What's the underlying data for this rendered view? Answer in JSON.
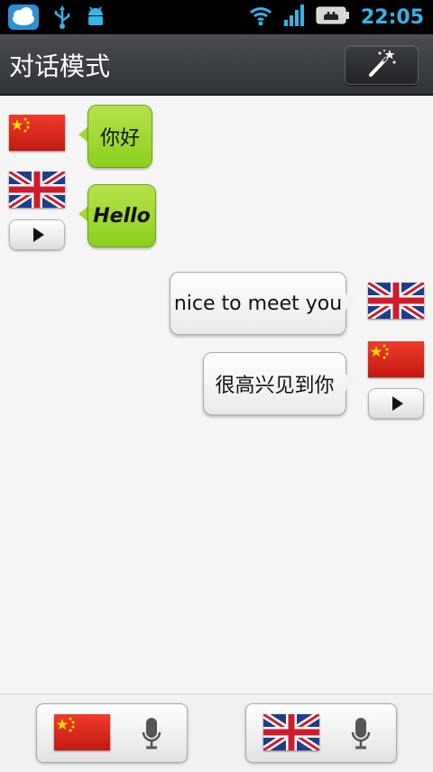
{
  "status_bar": {
    "time": "22:05",
    "icons": [
      "cloud-app-icon",
      "usb-icon",
      "android-debug-icon",
      "wifi-icon",
      "signal-icon",
      "battery-charging-icon"
    ]
  },
  "header": {
    "title": "对话模式",
    "action_icon": "magic-wand-icon"
  },
  "conversation": [
    {
      "side": "left",
      "flag": "china-flag",
      "text": "你好",
      "style": "normal",
      "bubble": "green"
    },
    {
      "side": "left",
      "flag": "uk-flag",
      "text": "Hello",
      "style": "bold-italic",
      "bubble": "green",
      "play_icon": "play-icon"
    },
    {
      "side": "right",
      "flag": "uk-flag",
      "text": "nice to meet you",
      "style": "normal",
      "bubble": "white"
    },
    {
      "side": "right",
      "flag": "china-flag",
      "text": "很高兴见到你",
      "style": "normal",
      "bubble": "white",
      "play_icon": "play-icon"
    }
  ],
  "bottom_bar": {
    "buttons": [
      {
        "flag": "china-flag",
        "icon": "microphone-icon"
      },
      {
        "flag": "uk-flag",
        "icon": "microphone-icon"
      }
    ]
  },
  "colors": {
    "status_accent": "#33b5e5",
    "bubble_green": "#9ed62f",
    "bubble_white": "#f2f2f2",
    "header_bg": "#3a3d41"
  }
}
